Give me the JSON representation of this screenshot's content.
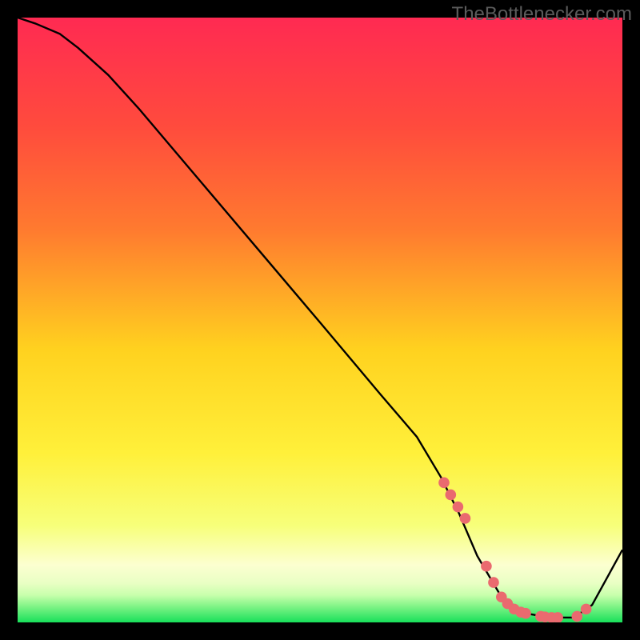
{
  "watermark": "TheBottlenecker.com",
  "colors": {
    "frame": "#000000",
    "grad_top": "#ff2a52",
    "grad_mid_upper": "#ff7a2f",
    "grad_mid": "#ffd21f",
    "grad_mid_lower": "#fff03a",
    "grad_pale": "#fcffd0",
    "grad_bottom": "#18e05a",
    "curve": "#000000",
    "marker_fill": "#ea6a6f",
    "marker_stroke": "#b94a50"
  },
  "chart_data": {
    "type": "line",
    "xlabel": "",
    "ylabel": "",
    "xlim": [
      0,
      100
    ],
    "ylim": [
      0,
      100
    ],
    "curve": {
      "x": [
        0,
        3,
        7,
        10,
        15,
        20,
        30,
        40,
        50,
        60,
        66,
        70,
        73,
        76,
        80,
        84,
        88,
        92,
        95,
        100
      ],
      "y": [
        100,
        99,
        97.3,
        95,
        90.5,
        85,
        73.2,
        61.4,
        49.6,
        37.7,
        30.7,
        24,
        18,
        11,
        4.2,
        1.5,
        0.8,
        0.8,
        2.9,
        12
      ]
    },
    "markers": {
      "x": [
        70.5,
        71.6,
        72.8,
        74,
        77.5,
        78.7,
        80,
        81,
        82.1,
        83.2,
        84,
        86.5,
        87.2,
        88.3,
        89.3,
        92.5,
        94
      ],
      "y": [
        23.1,
        21.1,
        19.1,
        17.2,
        9.3,
        6.6,
        4.2,
        3.1,
        2.2,
        1.7,
        1.5,
        1,
        0.9,
        0.8,
        0.8,
        1,
        2.2
      ]
    }
  }
}
